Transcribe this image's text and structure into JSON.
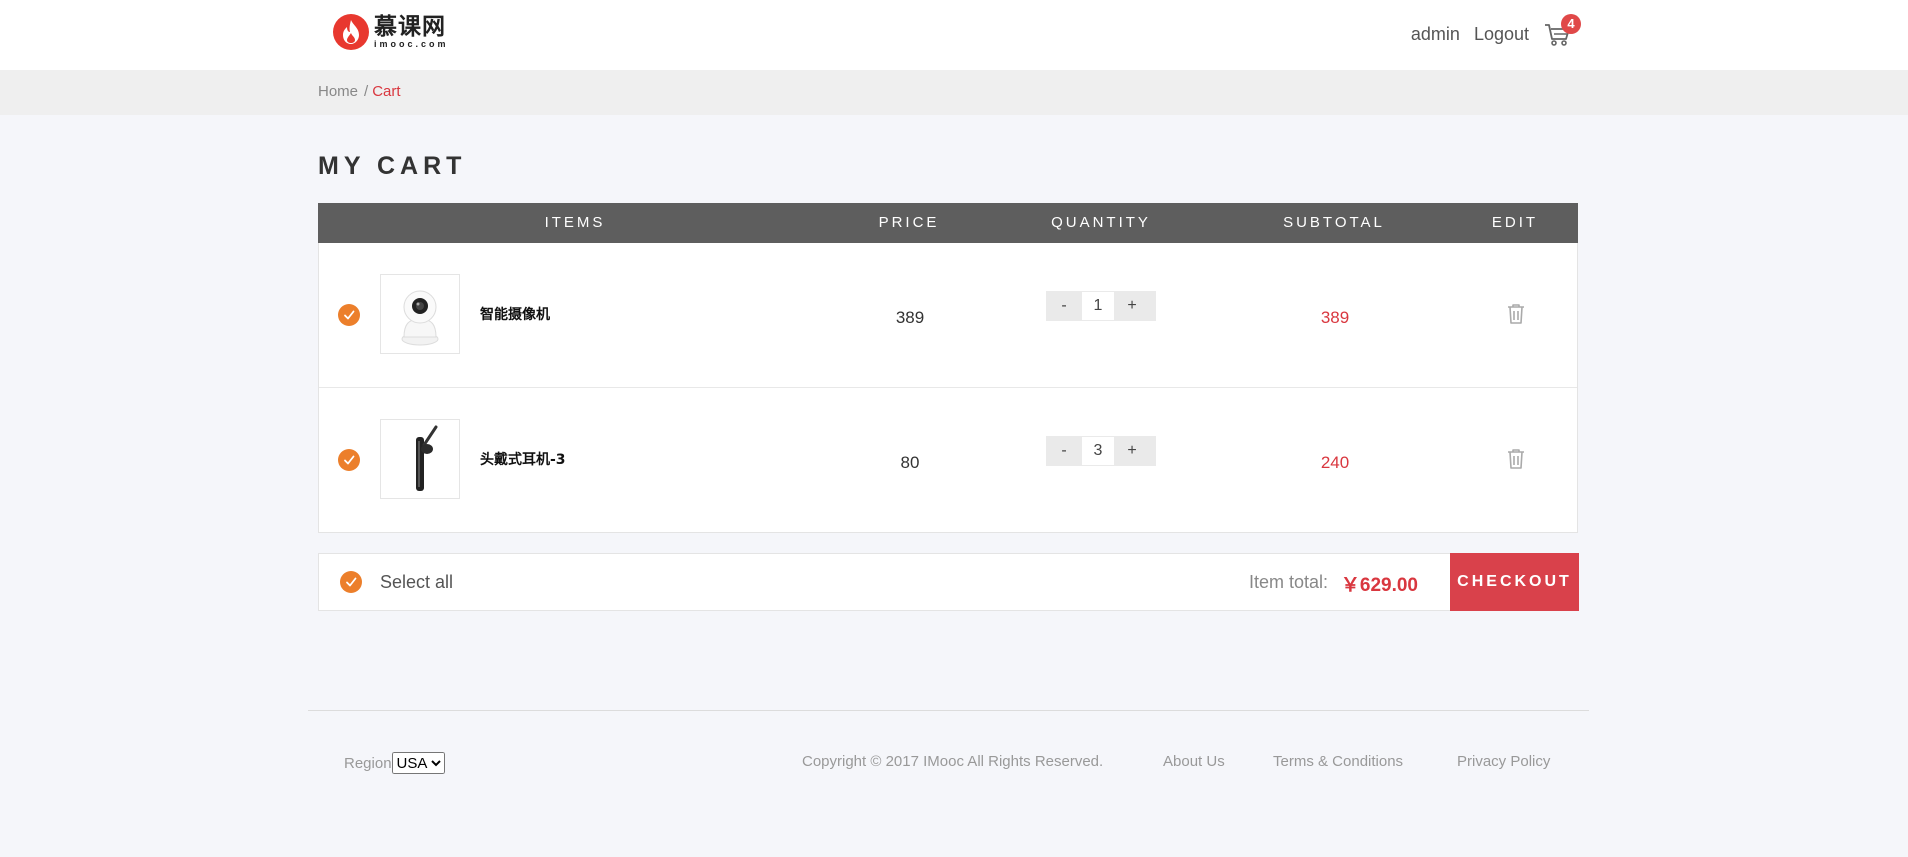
{
  "header": {
    "logo_cn": "慕课网",
    "logo_en": "imooc.com",
    "username": "admin",
    "logout_label": "Logout",
    "cart_count": "4"
  },
  "breadcrumb": {
    "home": "Home",
    "sep": "/",
    "current": "Cart"
  },
  "page_title": "MY CART",
  "table": {
    "headers": {
      "items": "ITEMS",
      "price": "PRICE",
      "quantity": "QUANTITY",
      "subtotal": "SUBTOTAL",
      "edit": "EDIT"
    },
    "rows": [
      {
        "name": "智能摄像机",
        "price": "389",
        "qty": "1",
        "subtotal": "389",
        "checked": true,
        "image": "camera"
      },
      {
        "name": "头戴式耳机-3",
        "price": "80",
        "qty": "3",
        "subtotal": "240",
        "checked": true,
        "image": "headset"
      }
    ],
    "minus_label": "-",
    "plus_label": "+"
  },
  "summary": {
    "select_all": "Select all",
    "item_total_label": "Item total:",
    "item_total_value": "￥629.00",
    "checkout_label": "CHECKOUT"
  },
  "footer": {
    "region_label": "Region",
    "region_value": "USA",
    "copyright": "Copyright © 2017 IMooc All Rights Reserved.",
    "about": "About Us",
    "terms": "Terms & Conditions",
    "privacy": "Privacy Policy"
  },
  "colors": {
    "accent": "#d9373f",
    "check": "#ec7f2b",
    "header_bar": "#5e5e5e"
  }
}
